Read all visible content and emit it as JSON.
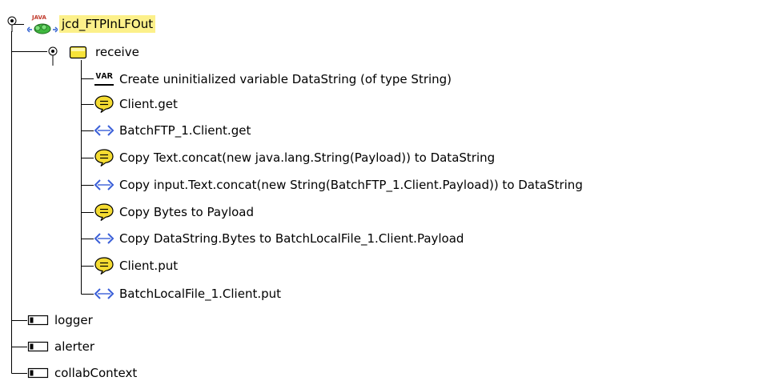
{
  "tree": {
    "root": {
      "label": "jcd_FTPInLFOut",
      "icon": "java-collaboration-icon",
      "badge": "JAVA",
      "selected": true,
      "expanded": true
    },
    "receive": {
      "label": "receive",
      "icon": "folder-icon",
      "expanded": true,
      "children": [
        {
          "label": "Create uninitialized variable DataString (of type String)",
          "icon": "var-icon",
          "badge": "VAR"
        },
        {
          "label": "Client.get",
          "icon": "comment-icon"
        },
        {
          "label": "BatchFTP_1.Client.get",
          "icon": "code-icon"
        },
        {
          "label": "Copy Text.concat(new java.lang.String(Payload)) to DataString",
          "icon": "comment-icon"
        },
        {
          "label": "Copy input.Text.concat(new String(BatchFTP_1.Client.Payload)) to DataString",
          "icon": "code-icon"
        },
        {
          "label": "Copy Bytes to Payload",
          "icon": "comment-icon"
        },
        {
          "label": "Copy DataString.Bytes to BatchLocalFile_1.Client.Payload",
          "icon": "code-icon"
        },
        {
          "label": "Client.put",
          "icon": "comment-icon"
        },
        {
          "label": "BatchLocalFile_1.Client.put",
          "icon": "code-icon"
        }
      ]
    },
    "fields": [
      {
        "label": "logger",
        "icon": "field-icon"
      },
      {
        "label": "alerter",
        "icon": "field-icon"
      },
      {
        "label": "collabContext",
        "icon": "field-icon"
      }
    ]
  },
  "colors": {
    "selection": "#fcf08a",
    "folder_fill": "#f7e33a",
    "comment_fill": "#f5dc32",
    "code_arrow": "#3a5fd8",
    "java_badge": "#c0392b",
    "java_green": "#2e8b2e"
  }
}
